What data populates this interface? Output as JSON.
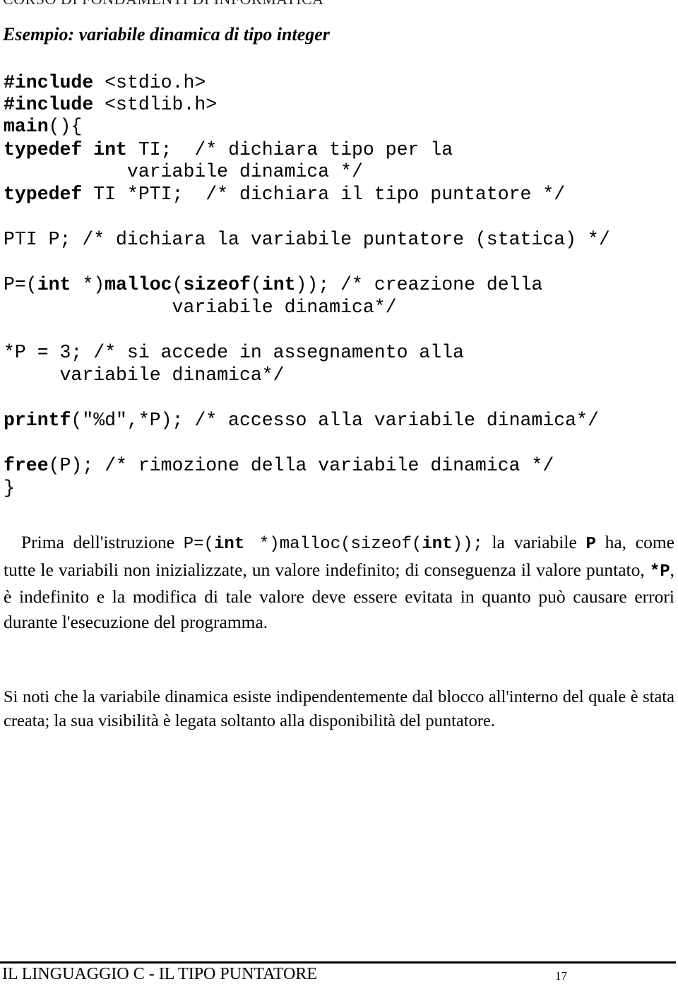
{
  "header": {
    "course": "CORSO DI FONDAMENTI DI INFORMATICA"
  },
  "title": "Esempio: variabile dinamica di tipo integer",
  "code": {
    "l1_kw": "#include",
    "l1_rest": " <stdio.h>",
    "l2_kw": "#include",
    "l2_rest": " <stdlib.h>",
    "l3_kw": "main",
    "l3_rest": "(){",
    "l4_kw1": "typedef",
    "l4_kw2": "int",
    "l4_rest": " TI;  /* dichiara tipo per la",
    "l5": "           variabile dinamica */",
    "l6_kw": "typedef",
    "l6_rest": " TI *PTI;  /* dichiara il tipo puntatore */",
    "l7": "PTI P; /* dichiara la variabile puntatore (statica) */",
    "l8_a": "P=(",
    "l8_kw1": "int",
    "l8_b": " *)",
    "l8_kw2": "malloc",
    "l8_c": "(",
    "l8_kw3": "sizeof",
    "l8_d": "(",
    "l8_kw4": "int",
    "l8_e": ")); /* creazione della",
    "l9": "               variabile dinamica*/",
    "l10": "*P = 3; /* si accede in assegnamento alla",
    "l11": "     variabile dinamica*/",
    "l12_kw": "printf",
    "l12_rest": "(\"%d\",*P); /* accesso alla variabile dinamica*/",
    "l13_kw": "free",
    "l13_rest": "(P); /* rimozione della variabile dinamica */",
    "l14": "}"
  },
  "para1": {
    "t1": "Prima dell'istruzione ",
    "c1": "P=(",
    "c1b": "int",
    "c1c": "  *)malloc(sizeof(",
    "c1d": "int",
    "c1e": "));",
    "t2": " la variabile ",
    "c2": "P",
    "t3": " ha, come tutte le variabili non inizializzate, un valore indefinito; di conseguenza il valore puntato, ",
    "c3": "*P",
    "t4": ", è indefinito e la modifica di tale valore deve essere evitata in quanto può causare errori durante l'esecuzione del programma."
  },
  "para2": "Si noti che la variabile dinamica esiste indipendentemente dal blocco all'interno del quale è stata creata; la sua visibilità è legata soltanto alla disponibilità del puntatore.",
  "footer": {
    "title": "IL LINGUAGGIO C - IL TIPO PUNTATORE",
    "page": "17"
  }
}
